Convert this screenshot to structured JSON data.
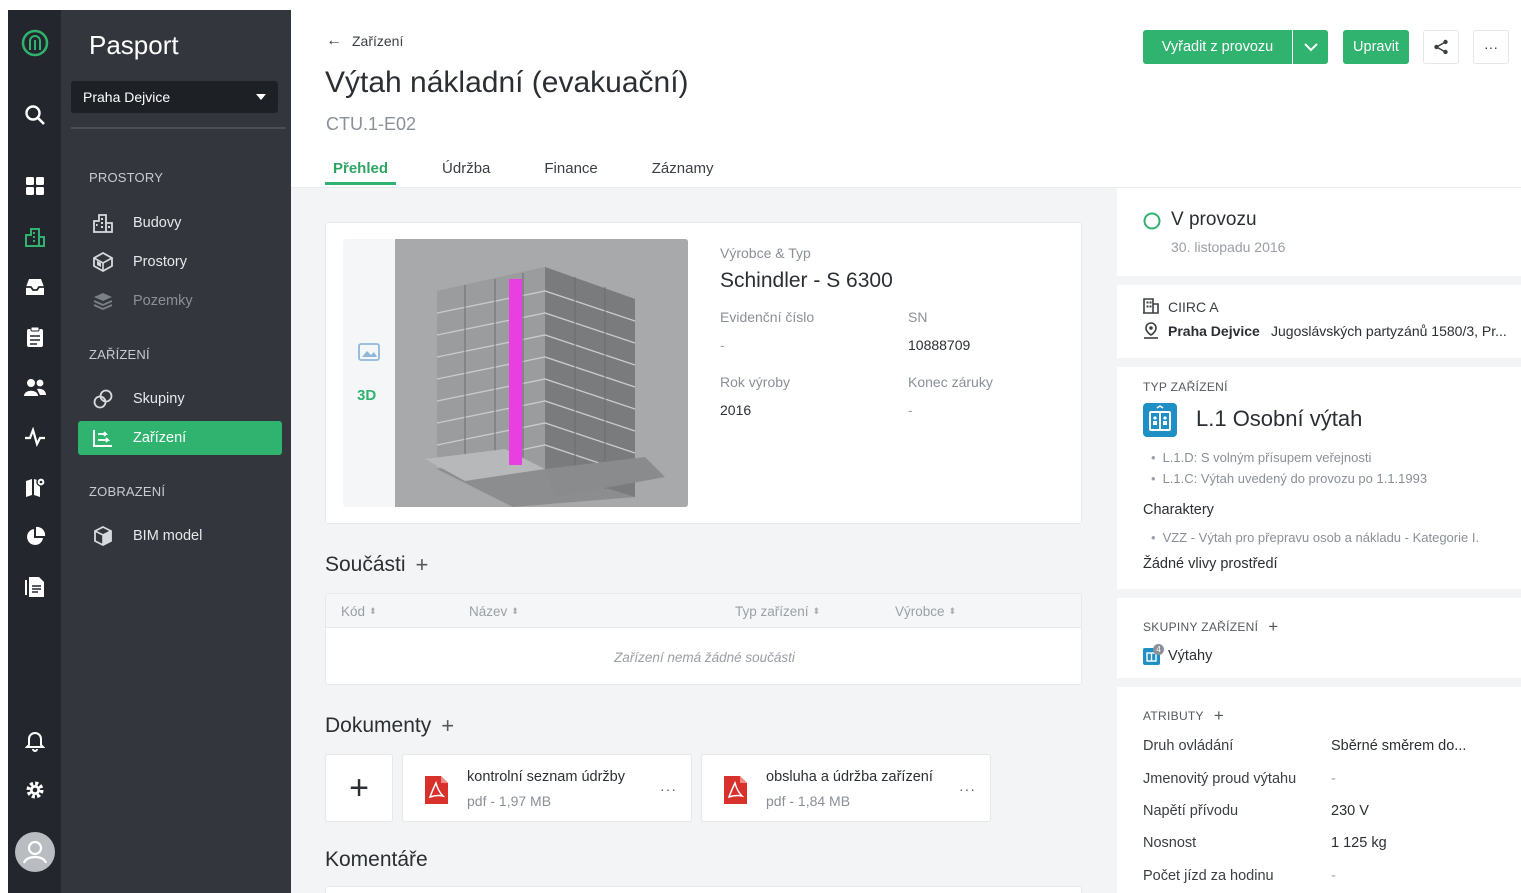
{
  "sidebar": {
    "app_title": "Pasport",
    "location": "Praha Dejvice",
    "sections": {
      "prostory": "PROSTORY",
      "zarizeni": "ZAŘÍZENÍ",
      "zobrazeni": "ZOBRAZENÍ"
    },
    "items": {
      "budovy": "Budovy",
      "prostory": "Prostory",
      "pozemky": "Pozemky",
      "skupiny": "Skupiny",
      "zarizeni": "Zařízení",
      "bim": "BIM model"
    }
  },
  "header": {
    "breadcrumb": "Zařízení",
    "title": "Výtah nákladní (evakuační)",
    "code": "CTU.1-E02",
    "tabs": [
      "Přehled",
      "Údržba",
      "Finance",
      "Záznamy"
    ],
    "decommission_label": "Vyřadit z provozu",
    "edit_label": "Upravit",
    "more_label": "···"
  },
  "overview": {
    "view_3d_label": "3D",
    "manufacturer_label": "Výrobce & Typ",
    "manufacturer_value": "Schindler - S 6300",
    "evidence_label": "Evidenční číslo",
    "evidence_value": "-",
    "sn_label": "SN",
    "sn_value": "10888709",
    "year_label": "Rok výroby",
    "year_value": "2016",
    "warranty_label": "Konec záruky",
    "warranty_value": "-"
  },
  "components": {
    "title": "Součásti",
    "columns": [
      "Kód",
      "Název",
      "Typ zařízení",
      "Výrobce"
    ],
    "empty": "Zařízení nemá žádné součásti"
  },
  "documents": {
    "title": "Dokumenty",
    "add_label": "+",
    "items": [
      {
        "name": "kontrolní seznam údržby",
        "meta": "pdf - 1,97 MB"
      },
      {
        "name": "obsluha a údržba zařízení",
        "meta": "pdf - 1,84 MB"
      }
    ],
    "more_label": "···"
  },
  "comments": {
    "title": "Komentáře"
  },
  "details": {
    "status": "V provozu",
    "status_date": "30. listopadu 2016",
    "building": "CIIRC A",
    "site": "Praha Dejvice",
    "address": "Jugoslávských partyzánů 1580/3, Pr...",
    "type_section": "TYP ZAŘÍZENÍ",
    "type_title": "L.1 Osobní výtah",
    "type_bullets": [
      "L.1.D: S volným přísupem veřejnosti",
      "L.1.C: Výtah uvedený do provozu po 1.1.1993"
    ],
    "char_title": "Charaktery",
    "char_bullets": [
      "VZZ - Výtah pro přepravu osob a nákladu - Kategorie I."
    ],
    "env_title": "Žádné vlivy prostředí",
    "groups_section": "SKUPINY ZAŘÍZENÍ",
    "group_badge": "4",
    "group_name": "Výtahy",
    "attrs_section": "ATRIBUTY",
    "attributes": [
      {
        "key": "Druh ovládání",
        "value": "Sběrné směrem do..."
      },
      {
        "key": "Jmenovitý proud výtahu",
        "value": "-"
      },
      {
        "key": "Napětí přívodu",
        "value": "230 V"
      },
      {
        "key": "Nosnost",
        "value": "1 125 kg"
      },
      {
        "key": "Počet jízd za hodinu",
        "value": "-"
      }
    ]
  },
  "colors": {
    "accent": "#2fb36e",
    "sidebar": "#33373d",
    "rail": "#23272d",
    "elevator_shaft": "#e83fe0"
  }
}
